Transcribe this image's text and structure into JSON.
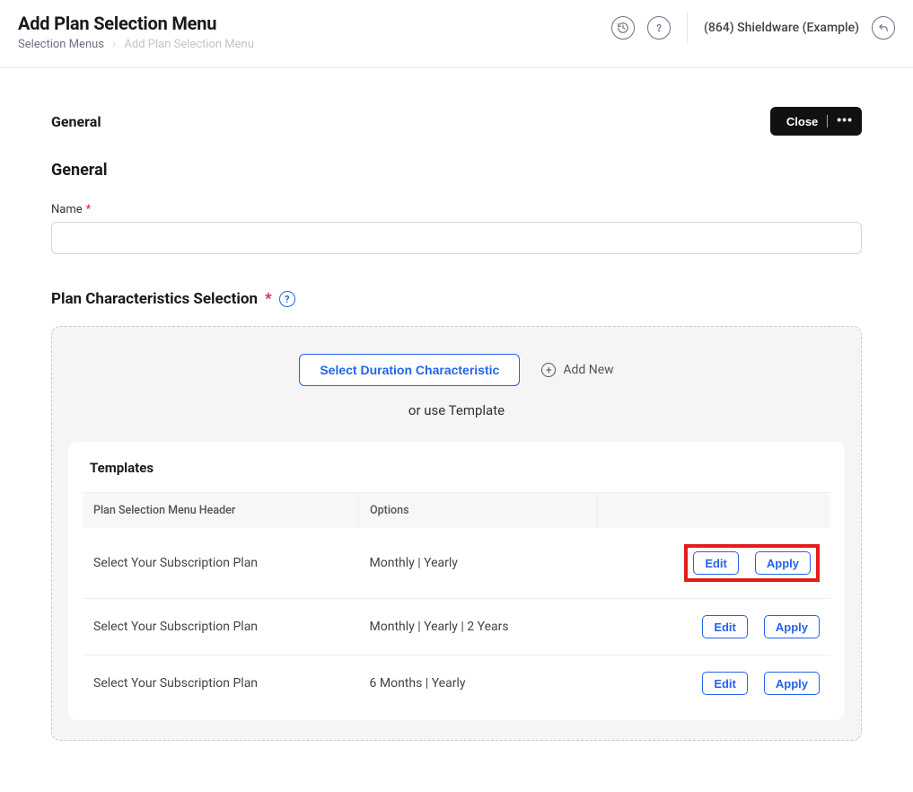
{
  "header": {
    "title": "Add Plan Selection Menu",
    "breadcrumb": {
      "parent": "Selection Menus",
      "current": "Add Plan Selection Menu"
    },
    "org_label": "(864) Shieldware (Example)"
  },
  "card": {
    "tab_label": "General",
    "close_label": "Close",
    "section_title": "General",
    "name_label": "Name",
    "name_value": "",
    "plan_char_title": "Plan Characteristics Selection",
    "select_duration_btn": "Select Duration Characteristic",
    "add_new_label": "Add New",
    "or_template": "or use Template",
    "templates_title": "Templates"
  },
  "table": {
    "columns": {
      "header": "Plan Selection Menu Header",
      "options": "Options"
    },
    "edit_label": "Edit",
    "apply_label": "Apply",
    "rows": [
      {
        "header": "Select Your Subscription Plan",
        "options": "Monthly | Yearly",
        "highlight": true
      },
      {
        "header": "Select Your Subscription Plan",
        "options": "Monthly | Yearly | 2 Years",
        "highlight": false
      },
      {
        "header": "Select Your Subscription Plan",
        "options": "6 Months | Yearly",
        "highlight": false
      }
    ]
  }
}
